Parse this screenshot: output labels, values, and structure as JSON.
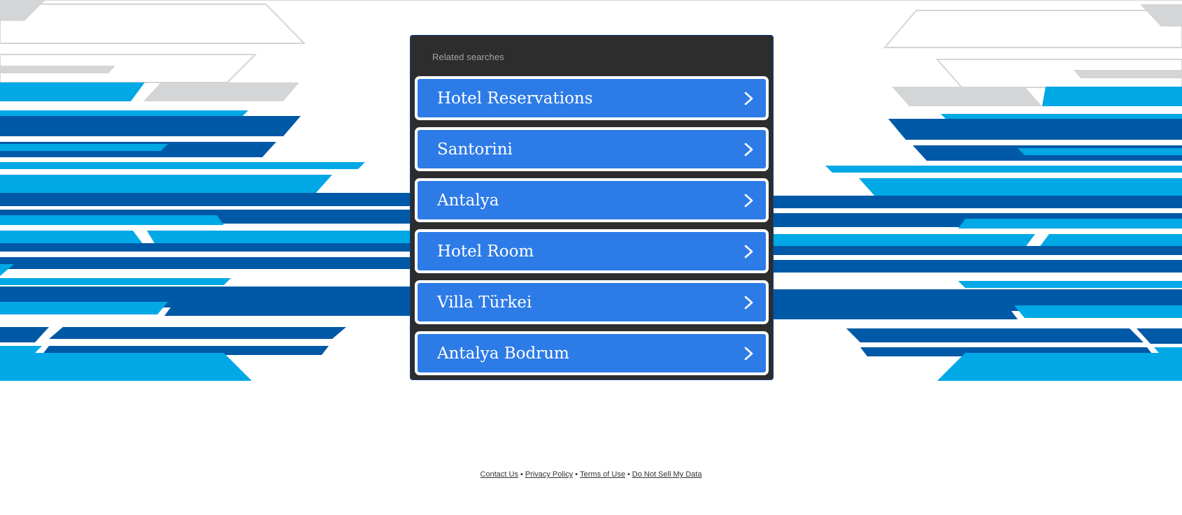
{
  "related": {
    "title": "Related searches",
    "items": [
      {
        "label": "Hotel Reservations"
      },
      {
        "label": "Santorini"
      },
      {
        "label": "Antalya"
      },
      {
        "label": "Hotel Room"
      },
      {
        "label": "Villa Türkei"
      },
      {
        "label": "Antalya Bodrum"
      }
    ]
  },
  "footer": {
    "links": [
      {
        "label": "Contact Us"
      },
      {
        "label": "Privacy Policy"
      },
      {
        "label": "Terms of Use"
      },
      {
        "label": "Do Not Sell My Data"
      }
    ],
    "separator": "•"
  },
  "colors": {
    "button_blue": "#2d7be6",
    "panel_bg": "#2d2d2d",
    "stripe_dark_blue": "#0059a6",
    "stripe_light_blue": "#00a8e6",
    "stripe_gray": "#d4d5d7"
  },
  "icons": {
    "button_arrow": "chevron-right-icon"
  }
}
